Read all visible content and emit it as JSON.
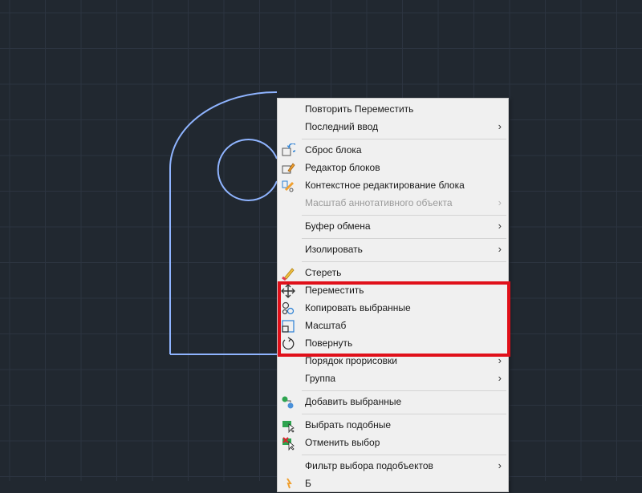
{
  "colors": {
    "background": "#212830",
    "grid": "#2c3440",
    "outline": "#8fb4ff",
    "menu_bg": "#f0f0f0",
    "highlight": "#e0101a"
  },
  "menu": {
    "items": [
      {
        "label": "Повторить Переместить",
        "icon": "",
        "submenu": false,
        "disabled": false
      },
      {
        "label": "Последний ввод",
        "icon": "",
        "submenu": true,
        "disabled": false
      },
      {
        "label": "Сброс блока",
        "icon": "block-reset-icon",
        "submenu": false,
        "disabled": false
      },
      {
        "label": "Редактор блоков",
        "icon": "block-editor-icon",
        "submenu": false,
        "disabled": false
      },
      {
        "label": "Контекстное редактирование блока",
        "icon": "inplace-edit-block-icon",
        "submenu": false,
        "disabled": false
      },
      {
        "label": "Масштаб аннотативного объекта",
        "icon": "",
        "submenu": true,
        "disabled": true
      },
      {
        "label": "Буфер обмена",
        "icon": "",
        "submenu": true,
        "disabled": false
      },
      {
        "label": "Изолировать",
        "icon": "",
        "submenu": true,
        "disabled": false
      },
      {
        "label": "Стереть",
        "icon": "eraser-icon",
        "submenu": false,
        "disabled": false
      },
      {
        "label": "Переместить",
        "icon": "move-icon",
        "submenu": false,
        "disabled": false
      },
      {
        "label": "Копировать выбранные",
        "icon": "copy-selected-icon",
        "submenu": false,
        "disabled": false
      },
      {
        "label": "Масштаб",
        "icon": "scale-icon",
        "submenu": false,
        "disabled": false
      },
      {
        "label": "Повернуть",
        "icon": "rotate-icon",
        "submenu": false,
        "disabled": false
      },
      {
        "label": "Порядок прорисовки",
        "icon": "",
        "submenu": true,
        "disabled": false
      },
      {
        "label": "Группа",
        "icon": "",
        "submenu": true,
        "disabled": false
      },
      {
        "label": "Добавить выбранные",
        "icon": "add-selected-icon",
        "submenu": false,
        "disabled": false
      },
      {
        "label": "Выбрать подобные",
        "icon": "select-similar-icon",
        "submenu": false,
        "disabled": false
      },
      {
        "label": "Отменить выбор",
        "icon": "deselect-icon",
        "submenu": false,
        "disabled": false
      },
      {
        "label": "Фильтр выбора подобъектов",
        "icon": "",
        "submenu": true,
        "disabled": false
      },
      {
        "label": "Б",
        "icon": "quick-select-icon",
        "submenu": false,
        "disabled": false
      }
    ]
  }
}
